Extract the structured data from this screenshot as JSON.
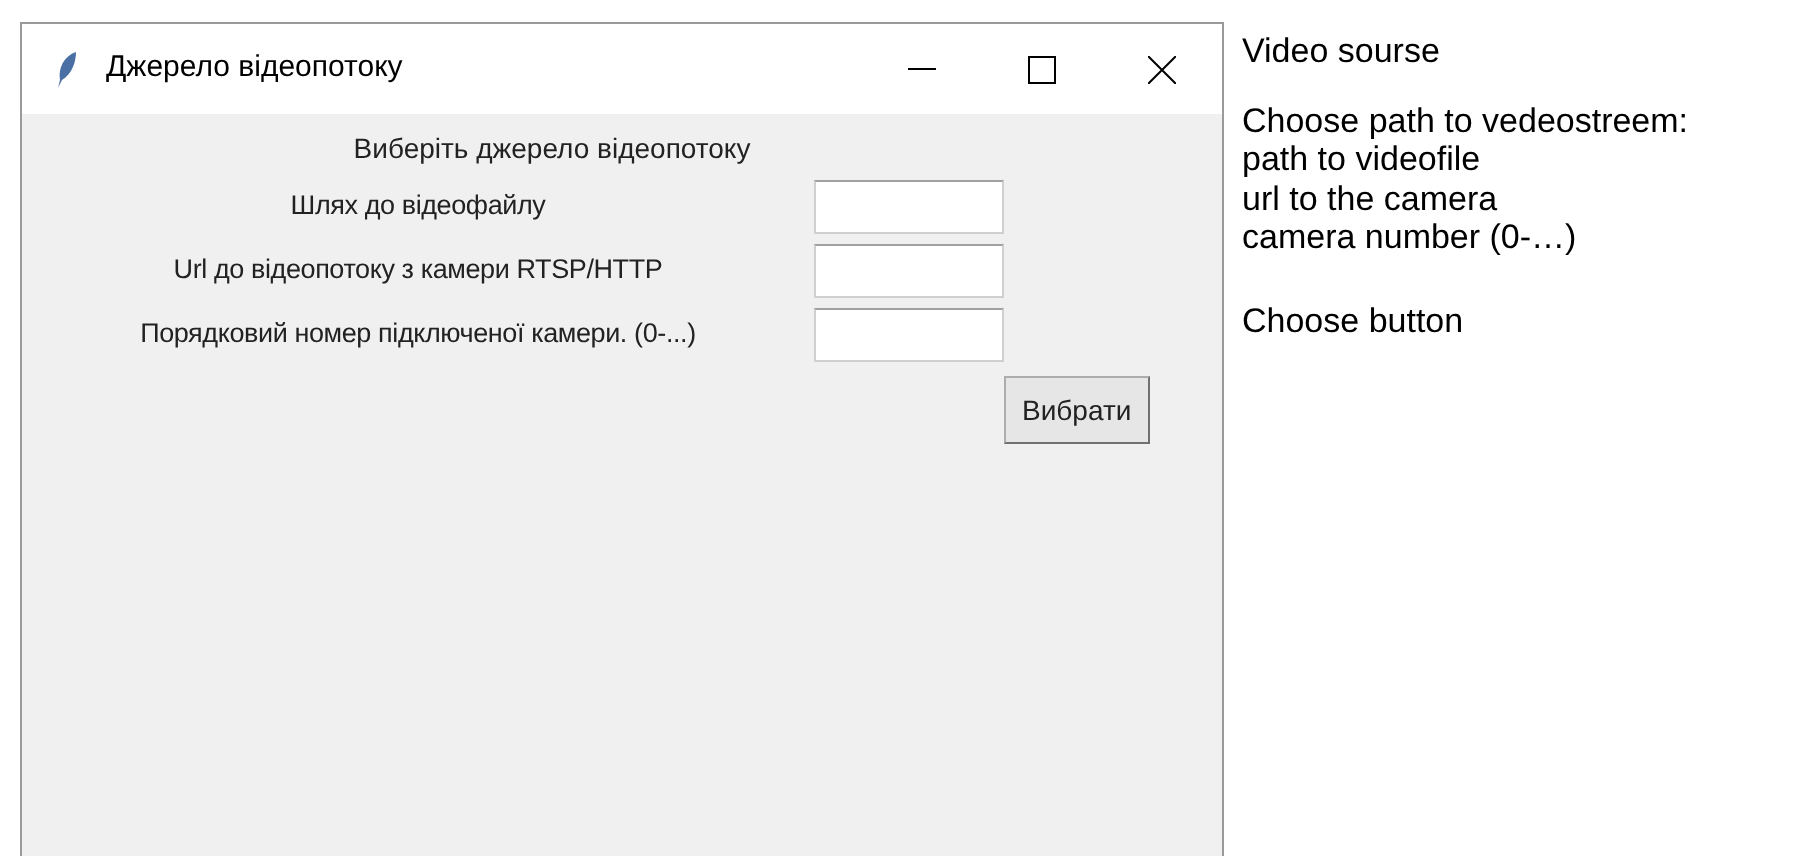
{
  "window": {
    "title": "Джерело відеопотоку"
  },
  "heading": "Виберіть джерело відеопотоку",
  "fields": [
    {
      "label": "Шлях до відеофайлу"
    },
    {
      "label": "Url до відеопотоку з камери RTSP/HTTP"
    },
    {
      "label": "Порядковий номер підключеної камери. (0-...)"
    }
  ],
  "button": "Вибрати",
  "notes": {
    "title": "Video sourse",
    "lines": [
      "Choose path to vedeostreem:",
      "path to videofile",
      "url to the camera",
      "camera number (0-…)"
    ],
    "footer": "Choose button"
  }
}
